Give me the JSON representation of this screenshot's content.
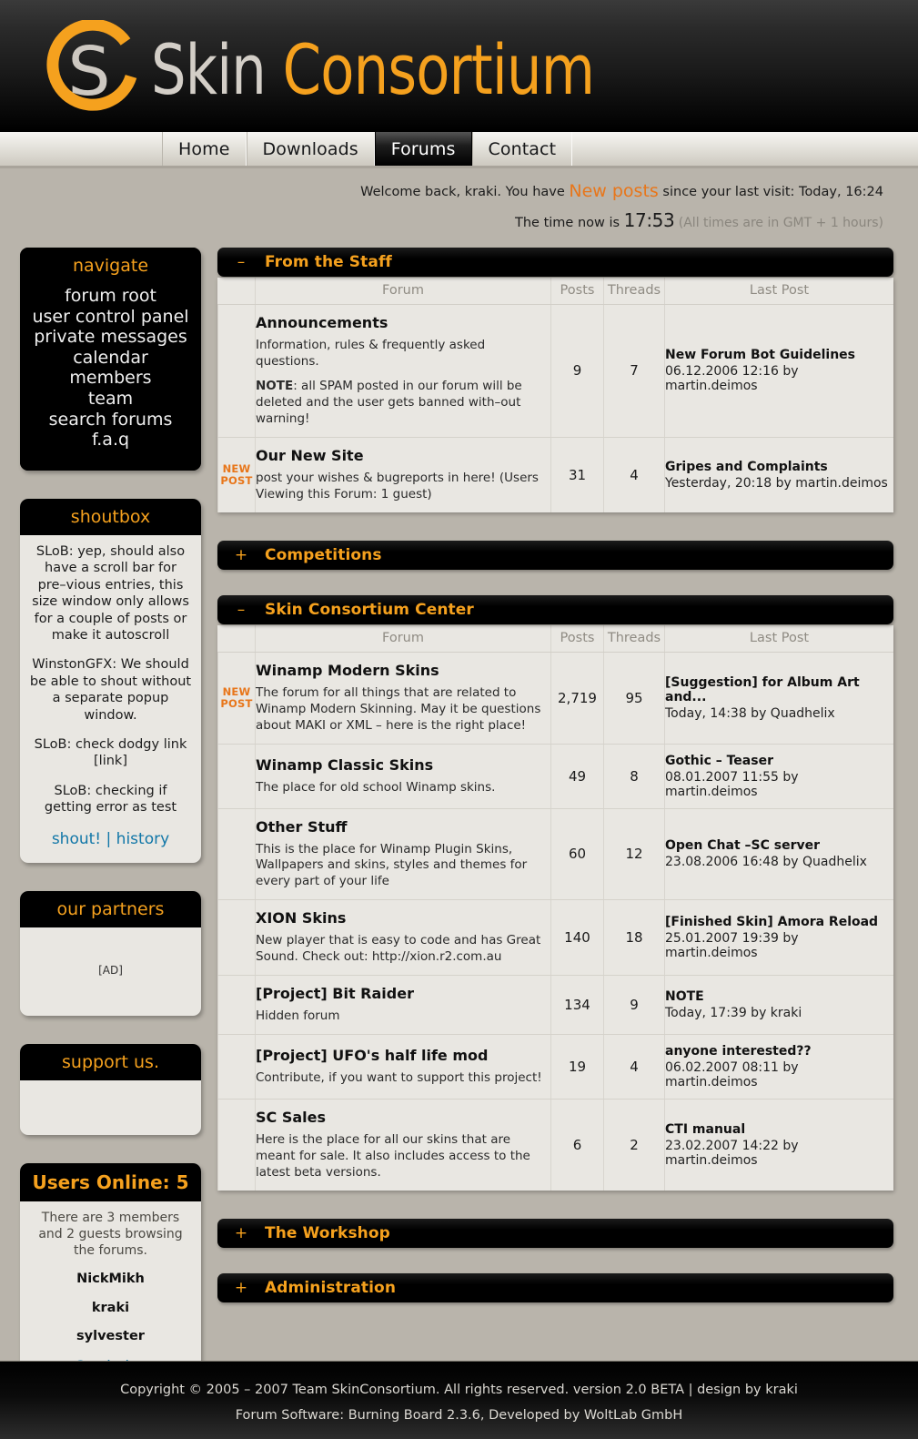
{
  "site": {
    "brand_first": "Skin",
    "brand_second": "Consortium",
    "logo_icon": "sc-circle-s-logo"
  },
  "nav": {
    "items": [
      {
        "label": "Home",
        "active": false
      },
      {
        "label": "Downloads",
        "active": false
      },
      {
        "label": "Forums",
        "active": true
      },
      {
        "label": "Contact",
        "active": false
      }
    ]
  },
  "welcome": {
    "prefix": "Welcome back, kraki. You have ",
    "highlight": "New posts",
    "suffix": " since your last visit: Today, 16:24",
    "time_prefix": "The time now is ",
    "time": "17:53",
    "timezone_note": " (All times are in GMT + 1 hours)"
  },
  "sidebar": {
    "navigate": {
      "title": "navigate",
      "items": [
        "forum root",
        "user control panel",
        "private messages",
        "calendar",
        "members",
        "team",
        "search forums",
        "f.a.q"
      ]
    },
    "shoutbox": {
      "title": "shoutbox",
      "messages": [
        "SLoB: yep, should also have a scroll bar for pre–vious entries, this size window only allows for a couple of posts or make it autoscroll",
        "WinstonGFX: We should be able to shout without a separate popup window.",
        "SLoB: check dodgy link [link]",
        "SLoB: checking if getting error as test"
      ],
      "shout_link": "shout!",
      "separator": "|",
      "history_link": "history"
    },
    "partners": {
      "title": "our partners",
      "ad_placeholder": "[AD]"
    },
    "support": {
      "title": "support us."
    },
    "users_online": {
      "title": "Users Online: 5",
      "summary": "There are 3 members and 2 guests browsing the forums.",
      "members": [
        "NickMikh",
        "kraki",
        "sylvester"
      ],
      "statistics_link": "Statistics"
    }
  },
  "columns": {
    "flag": "",
    "forum": "Forum",
    "posts": "Posts",
    "threads": "Threads",
    "last_post": "Last Post"
  },
  "categories": [
    {
      "title": "From the Staff",
      "collapsed": false,
      "toggle": "–",
      "forums": [
        {
          "flag": "",
          "name": "Announcements",
          "desc_parts": [
            {
              "text": "Information, rules & frequently asked questions."
            },
            {
              "bold": "NOTE",
              "text": ": all SPAM posted in our forum will be deleted and the user gets banned with–out warning!"
            }
          ],
          "posts": "9",
          "threads": "7",
          "last_title": "New Forum Bot Guidelines",
          "last_meta": "06.12.2006 12:16 by martin.deimos"
        },
        {
          "flag": "NEW POST",
          "name": "Our New Site",
          "desc_parts": [
            {
              "text": "post your wishes & bugreports in here! (Users Viewing this Forum: 1 guest)"
            }
          ],
          "posts": "31",
          "threads": "4",
          "last_title": "Gripes and Complaints",
          "last_meta": "Yesterday, 20:18 by martin.deimos"
        }
      ]
    },
    {
      "title": "Competitions",
      "collapsed": true,
      "toggle": "+",
      "forums": []
    },
    {
      "title": "Skin Consortium Center",
      "collapsed": false,
      "toggle": "–",
      "forums": [
        {
          "flag": "NEW POST",
          "name": "Winamp Modern Skins",
          "desc_parts": [
            {
              "text": "The forum for all things that are related to Winamp Modern Skinning. May it be questions about MAKI or XML – here is the right place!"
            }
          ],
          "posts": "2,719",
          "threads": "95",
          "last_title": "[Suggestion] for Album Art and...",
          "last_meta": "Today, 14:38 by Quadhelix"
        },
        {
          "flag": "",
          "name": "Winamp Classic Skins",
          "desc_parts": [
            {
              "text": "The place for old school Winamp skins."
            }
          ],
          "posts": "49",
          "threads": "8",
          "last_title": "Gothic – Teaser",
          "last_meta": "08.01.2007 11:55 by martin.deimos"
        },
        {
          "flag": "",
          "name": "Other Stuff",
          "desc_parts": [
            {
              "text": "This is the place for Winamp Plugin Skins, Wallpapers and skins, styles and themes for every part of your life"
            }
          ],
          "posts": "60",
          "threads": "12",
          "last_title": "Open Chat –SC server",
          "last_meta": "23.08.2006 16:48 by Quadhelix"
        },
        {
          "flag": "",
          "name": "XION Skins",
          "desc_parts": [
            {
              "text": "New player that is easy to code and has Great Sound. Check out: http://xion.r2.com.au"
            }
          ],
          "posts": "140",
          "threads": "18",
          "last_title": "[Finished Skin] Amora Reload",
          "last_meta": "25.01.2007 19:39 by martin.deimos"
        },
        {
          "flag": "",
          "name": "[Project] Bit Raider",
          "desc_parts": [
            {
              "text": "Hidden forum"
            }
          ],
          "posts": "134",
          "threads": "9",
          "last_title": "NOTE",
          "last_meta": "Today, 17:39 by kraki"
        },
        {
          "flag": "",
          "name": "[Project] UFO's half life mod",
          "desc_parts": [
            {
              "text": "Contribute, if you want to support this project!"
            }
          ],
          "posts": "19",
          "threads": "4",
          "last_title": "anyone interested??",
          "last_meta": "06.02.2007 08:11 by martin.deimos"
        },
        {
          "flag": "",
          "name": "SC Sales",
          "desc_parts": [
            {
              "text": "Here is the place for all our skins that are meant for sale. It also includes access to the latest beta versions."
            }
          ],
          "posts": "6",
          "threads": "2",
          "last_title": "CTI manual",
          "last_meta": "23.02.2007 14:22 by martin.deimos"
        }
      ]
    },
    {
      "title": "The Workshop",
      "collapsed": true,
      "toggle": "+",
      "forums": []
    },
    {
      "title": "Administration",
      "collapsed": true,
      "toggle": "+",
      "forums": []
    }
  ],
  "footer": {
    "line1": "Copyright © 2005 – 2007 Team SkinConsortium. All rights reserved. version 2.0 BETA | design by kraki",
    "line2": "Forum Software: Burning Board 2.3.6, Developed by WoltLab GmbH"
  },
  "colors": {
    "accent_orange": "#f5a11e",
    "new_post_orange": "#e8761a",
    "link_blue": "#1277a8",
    "page_bg": "#b9b4ab",
    "panel_bg": "#e9e7e2"
  }
}
